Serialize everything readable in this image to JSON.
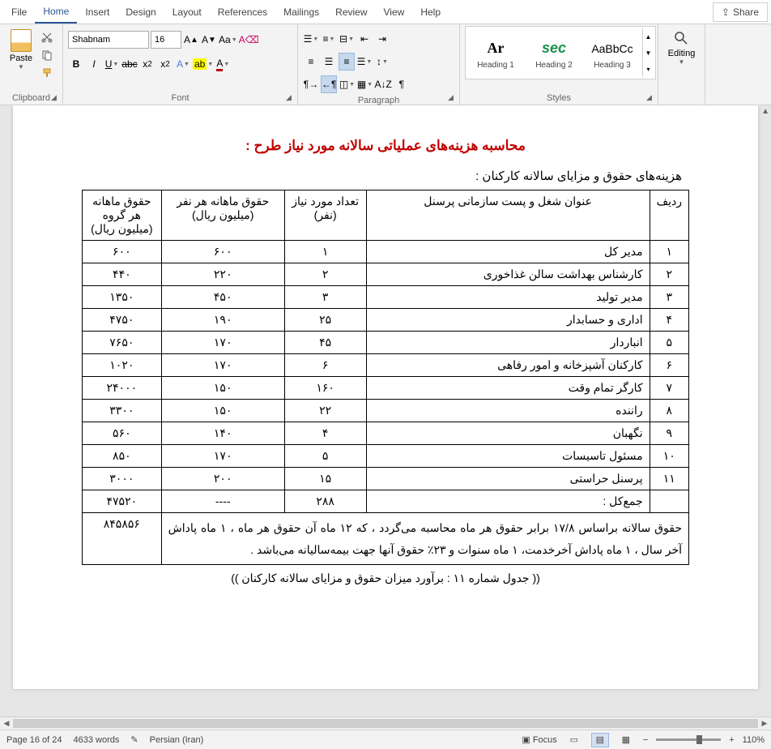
{
  "tabs": {
    "file": "File",
    "home": "Home",
    "insert": "Insert",
    "design": "Design",
    "layout": "Layout",
    "references": "References",
    "mailings": "Mailings",
    "review": "Review",
    "view": "View",
    "help": "Help"
  },
  "share": "Share",
  "ribbon": {
    "clipboard": {
      "label": "Clipboard",
      "paste": "Paste"
    },
    "font": {
      "label": "Font",
      "name": "Shabnam",
      "size": "16"
    },
    "paragraph": {
      "label": "Paragraph"
    },
    "styles": {
      "label": "Styles",
      "heading1": "Heading 1",
      "heading2": "Heading 2",
      "heading3": "Heading 3",
      "preview_h1": "Ar",
      "preview_h2": "sec",
      "preview_h3": "AaBbCc"
    },
    "editing": {
      "label": "Editing"
    }
  },
  "document": {
    "title_red": "محاسبه هزینه‌های عملیاتی سالانه مورد نیاز طرح :",
    "subtitle": "هزینه‌های حقوق و مزایای سالانه کارکنان :",
    "headers": {
      "radif": "ردیف",
      "position": "عنوان شغل و پست سازمانی پرسنل",
      "count": "تعداد مورد نیاز (نفر)",
      "per_person": "حقوق ماهانه هر نفر (میلیون ریال)",
      "per_group": "حقوق ماهانه هر گروه (میلیون ریال)"
    },
    "rows": [
      {
        "n": "۱",
        "pos": "مدیر کل",
        "cnt": "۱",
        "pp": "۶۰۰",
        "pg": "۶۰۰"
      },
      {
        "n": "۲",
        "pos": "کارشناس بهداشت سالن غذاخوری",
        "cnt": "۲",
        "pp": "۲۲۰",
        "pg": "۴۴۰"
      },
      {
        "n": "۳",
        "pos": "مدیر تولید",
        "cnt": "۳",
        "pp": "۴۵۰",
        "pg": "۱۳۵۰"
      },
      {
        "n": "۴",
        "pos": "اداری و حسابدار",
        "cnt": "۲۵",
        "pp": "۱۹۰",
        "pg": "۴۷۵۰"
      },
      {
        "n": "۵",
        "pos": "انباردار",
        "cnt": "۴۵",
        "pp": "۱۷۰",
        "pg": "۷۶۵۰"
      },
      {
        "n": "۶",
        "pos": "کارکنان آشپزخانه و امور رفاهی",
        "cnt": "۶",
        "pp": "۱۷۰",
        "pg": "۱۰۲۰"
      },
      {
        "n": "۷",
        "pos": "کارگر تمام وقت",
        "cnt": "۱۶۰",
        "pp": "۱۵۰",
        "pg": "۲۴۰۰۰"
      },
      {
        "n": "۸",
        "pos": "راننده",
        "cnt": "۲۲",
        "pp": "۱۵۰",
        "pg": "۳۳۰۰"
      },
      {
        "n": "۹",
        "pos": "نگهبان",
        "cnt": "۴",
        "pp": "۱۴۰",
        "pg": "۵۶۰"
      },
      {
        "n": "۱۰",
        "pos": "مسئول تاسیسات",
        "cnt": "۵",
        "pp": "۱۷۰",
        "pg": "۸۵۰"
      },
      {
        "n": "۱۱",
        "pos": "پرسنل حراستی",
        "cnt": "۱۵",
        "pp": "۲۰۰",
        "pg": "۳۰۰۰"
      }
    ],
    "total": {
      "label": "جمع‌کل :",
      "cnt": "۲۸۸",
      "pp": "----",
      "pg": "۴۷۵۲۰"
    },
    "footnote_text": "حقوق سالانه براساس ۱۷/۸ برابر حقوق هر ماه محاسبه  می‌گردد ، که ۱۲ ماه آن حقوق هر ماه ، ۱ ماه پاداش آخر سال ، ۱ ماه پاداش آخرخدمت، ۱ ماه سنوات و ۲۳٪ حقوق آنها جهت بیمه‌سالیانه می‌باشد .",
    "footnote_value": "۸۴۵۸۵۶",
    "caption": "(( جدول شماره ۱۱ : برآورد میزان حقوق و مزایای سالانه کارکنان ))"
  },
  "status": {
    "page": "Page 16 of 24",
    "words": "4633 words",
    "lang": "Persian (Iran)",
    "focus": "Focus",
    "zoom": "110%"
  }
}
